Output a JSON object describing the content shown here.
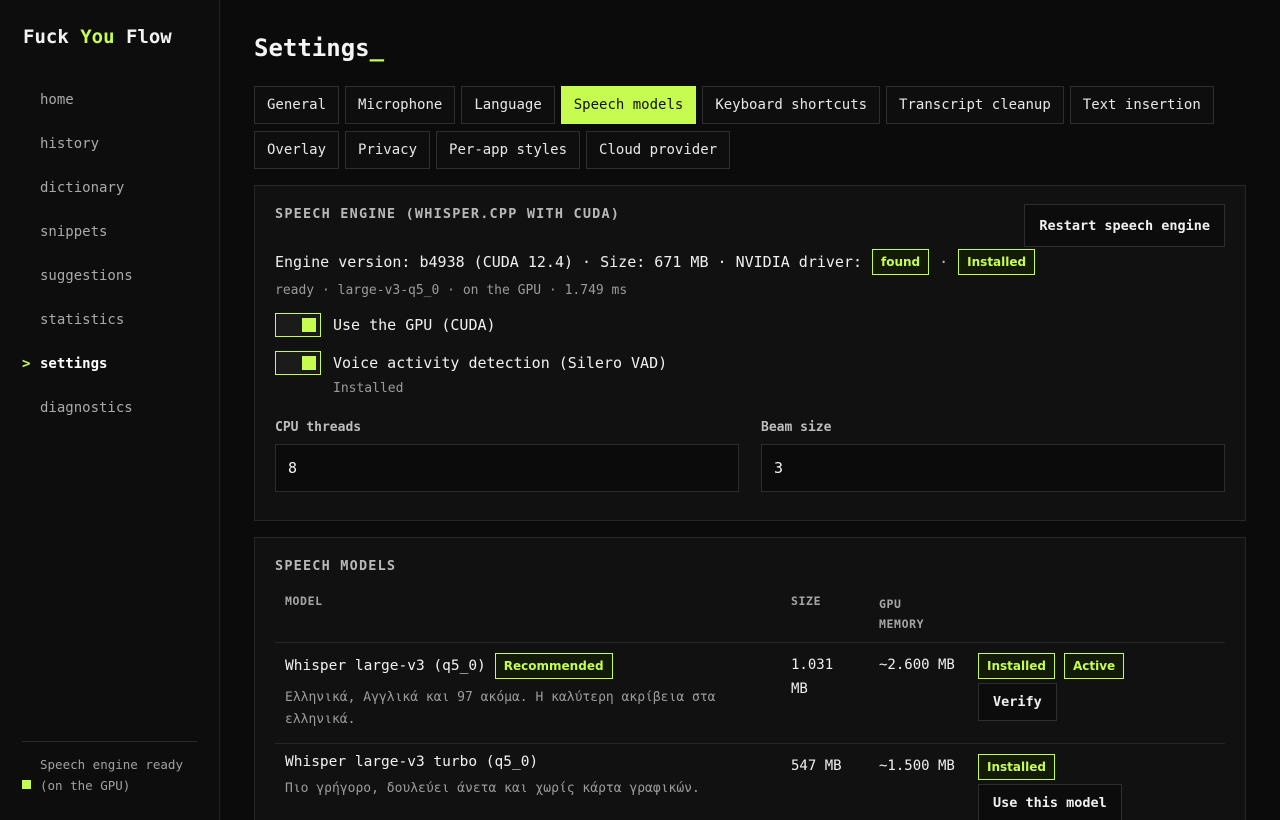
{
  "sidebar": {
    "brand": {
      "part1": "Fuck ",
      "part2": "You",
      "part3": " Flow"
    },
    "items": [
      {
        "label": "home"
      },
      {
        "label": "history"
      },
      {
        "label": "dictionary"
      },
      {
        "label": "snippets"
      },
      {
        "label": "suggestions"
      },
      {
        "label": "statistics"
      },
      {
        "label": "settings",
        "active": true
      },
      {
        "label": "diagnostics"
      }
    ],
    "active_marker": ">",
    "footer_status": "Speech engine ready (on the GPU)"
  },
  "page": {
    "title": "Settings",
    "cursor": "_"
  },
  "tabs": [
    {
      "label": "General"
    },
    {
      "label": "Microphone"
    },
    {
      "label": "Language"
    },
    {
      "label": "Speech models",
      "active": true
    },
    {
      "label": "Keyboard shortcuts"
    },
    {
      "label": "Transcript cleanup"
    },
    {
      "label": "Text insertion"
    },
    {
      "label": "Overlay"
    },
    {
      "label": "Privacy"
    },
    {
      "label": "Per-app styles"
    },
    {
      "label": "Cloud provider"
    }
  ],
  "engine": {
    "section_title": "SPEECH ENGINE (WHISPER.CPP WITH CUDA)",
    "restart_label": "Restart speech engine",
    "version_text": "Engine version: b4938 (CUDA 12.4) · Size: 671 MB · NVIDIA driver:",
    "driver_badge": "found",
    "separator": "·",
    "installed_badge": "Installed",
    "status_line": "ready · large-v3-q5_0 · on the GPU · 1.749 ms",
    "gpu_toggle": {
      "label": "Use the GPU (CUDA)",
      "on": true
    },
    "vad_toggle": {
      "label": "Voice activity detection (Silero VAD)",
      "on": true,
      "sub": "Installed"
    },
    "cpu_threads": {
      "label": "CPU threads",
      "value": "8"
    },
    "beam_size": {
      "label": "Beam size",
      "value": "3"
    }
  },
  "models": {
    "section_title": "SPEECH MODELS",
    "headers": {
      "model": "MODEL",
      "size": "SIZE",
      "gpu_line1": "GPU",
      "gpu_line2": "MEMORY"
    },
    "rows": [
      {
        "name": "Whisper large-v3 (q5_0)",
        "badge": "Recommended",
        "desc": "Ελληνικά, Αγγλικά και 97 ακόμα. Η καλύτερη ακρίβεια στα ελληνικά.",
        "size_line1": "1.031",
        "size_line2": "MB",
        "gpu": "~2.600 MB",
        "status_badges": [
          "Installed",
          "Active"
        ],
        "action": "Verify"
      },
      {
        "name": "Whisper large-v3 turbo (q5_0)",
        "desc": "Πιο γρήγορο, δουλεύει άνετα και χωρίς κάρτα γραφικών.",
        "size": "547 MB",
        "gpu": "~1.500 MB",
        "status_badges": [
          "Installed"
        ],
        "action": "Use this model"
      }
    ]
  },
  "colors": {
    "accent": "#c6fb50",
    "background": "#0b0b0b",
    "card": "#111111"
  }
}
